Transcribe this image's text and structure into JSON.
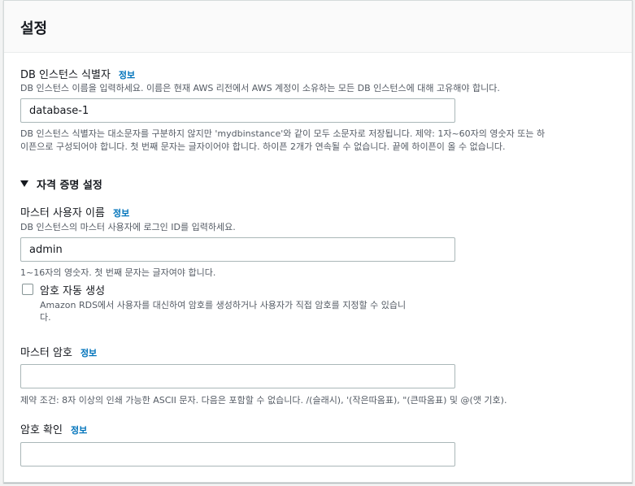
{
  "panel": {
    "title": "설정"
  },
  "identifier": {
    "label": "DB 인스턴스 식별자",
    "info": "정보",
    "description": "DB 인스턴스 이름을 입력하세요. 이름은 현재 AWS 리전에서 AWS 계정이 소유하는 모든 DB 인스턴스에 대해 고유해야 합니다.",
    "value": "database-1",
    "constraint_line1": "DB 인스턴스 식별자는 대소문자를 구분하지 않지만 'mydbinstance'와 같이 모두 소문자로 저장됩니다. 제약: 1자~60자의 영숫자 또는 하",
    "constraint_line2": "이픈으로 구성되어야 합니다. 첫 번째 문자는 글자이어야 합니다. 하이픈 2개가 연속될 수 없습니다. 끝에 하이픈이 올 수 없습니다."
  },
  "credentials": {
    "section_title": "자격 증명 설정",
    "expanded": true,
    "username": {
      "label": "마스터 사용자 이름",
      "info": "정보",
      "description": "DB 인스턴스의 마스터 사용자에 로그인 ID를 입력하세요.",
      "value": "admin",
      "constraint": "1~16자의 영숫자. 첫 번째 문자는 글자여야 합니다."
    },
    "auto_password": {
      "label": "암호 자동 생성",
      "checked": false,
      "description_line1": "Amazon RDS에서 사용자를 대신하여 암호를 생성하거나 사용자가 직접 암호를 지정할 수 있습니",
      "description_line2": "다."
    },
    "password": {
      "label": "마스터 암호",
      "info": "정보",
      "value": "",
      "constraint": "제약 조건: 8자 이상의 인쇄 가능한 ASCII 문자. 다음은 포함할 수 없습니다. /(슬래시), '(작은따옴표), \"(큰따옴표) 및 @(앳 기호)."
    },
    "confirm": {
      "label": "암호 확인",
      "info": "정보",
      "value": ""
    }
  }
}
